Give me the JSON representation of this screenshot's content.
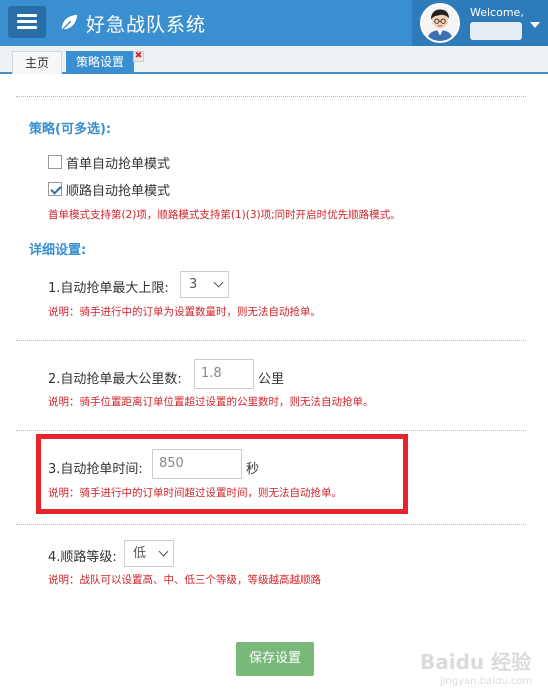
{
  "header": {
    "brand": "好急战队系统",
    "welcome": "Welcome,"
  },
  "tabs": {
    "home": "主页",
    "active": "策略设置",
    "close_glyph": "✖"
  },
  "strategy": {
    "title": "策略(可多选):",
    "options": [
      {
        "label": "首单自动抢单模式",
        "checked": false
      },
      {
        "label": "顺路自动抢单模式",
        "checked": true
      }
    ],
    "note": "首单模式支持第(2)项，顺路模式支持第(1)(3)项;同时开启时优先顺路模式。"
  },
  "details": {
    "title": "详细设置:",
    "max_orders": {
      "label": "1.自动抢单最大上限:",
      "value": "3",
      "note": "说明：骑手进行中的订单为设置数量时，则无法自动抢单。"
    },
    "max_distance": {
      "label": "2.自动抢单最大公里数:",
      "value": "1.8",
      "unit": "公里",
      "note": "说明：骑手位置距离订单位置超过设置的公里数时，则无法自动抢单。"
    },
    "grab_time": {
      "label": "3.自动抢单时间:",
      "value": "850",
      "unit": "秒",
      "note": "说明：骑手进行中的订单时间超过设置时间，则无法自动抢单。"
    },
    "route_level": {
      "label": "4.顺路等级:",
      "value": "低",
      "note": "说明：战队可以设置高、中、低三个等级，等级越高越顺路"
    }
  },
  "save_button": "保存设置",
  "watermark": {
    "logo": "Baidu 经验",
    "sub": "jingyan.baidu.com"
  },
  "colors": {
    "header_bg": "#3a8fd0",
    "accent": "#3a8fd0",
    "note_red": "#d2232a",
    "save_green": "#7ab87a",
    "highlight_red": "#e8232b"
  }
}
